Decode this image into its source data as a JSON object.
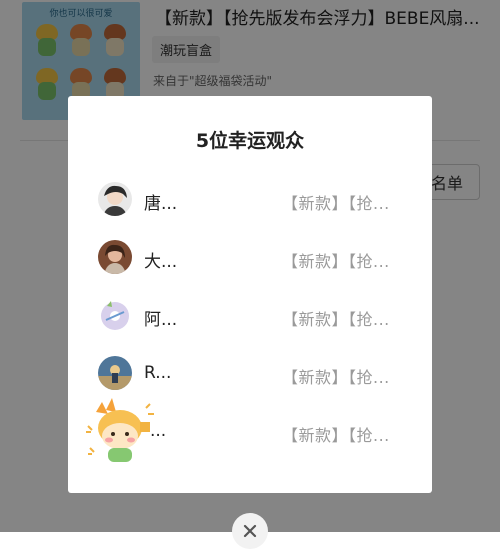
{
  "product": {
    "thumb_title": "你也可以很可爱",
    "title": "【新款】【抢先版发布会浮力】BEBE风扇...",
    "tag": "潮玩盲盒",
    "source": "来自于\"超级福袋活动\""
  },
  "list_button": {
    "label": "名单"
  },
  "modal": {
    "title": "5位幸运观众",
    "winners": [
      {
        "name": "唐...",
        "prize": "【新款】【抢...",
        "avatar_color": "#d9d9d9"
      },
      {
        "name": "大...",
        "prize": "【新款】【抢...",
        "avatar_color": "#8d5a3c"
      },
      {
        "name": "阿...",
        "prize": "【新款】【抢...",
        "avatar_color": "#b9a4d8"
      },
      {
        "name": "R...",
        "prize": "【新款】【抢...",
        "avatar_color": "#6d8fae"
      },
      {
        "name": "...",
        "prize": "【新款】【抢...",
        "avatar_color": "#f2c25a"
      }
    ]
  },
  "icons": {
    "close": "close-icon",
    "sticker": "sticker-character-icon"
  },
  "colors": {
    "overlay": "rgba(0,0,0,0.48)",
    "prize_text": "#9a9a9a",
    "thumb_bg": "#a9d9ee"
  }
}
